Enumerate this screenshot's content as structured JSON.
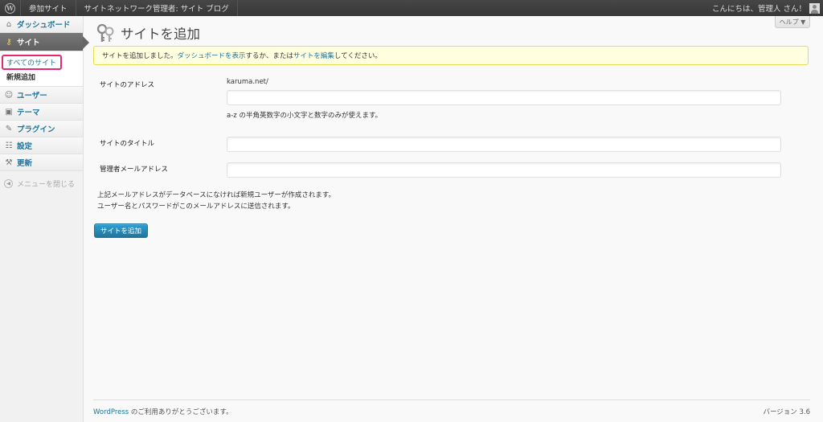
{
  "adminbar": {
    "wp_logo": "W",
    "item1": "参加サイト",
    "item2": "サイトネットワーク管理者: サイト ブログ",
    "greeting": "こんにちは、管理人 さん！"
  },
  "sidebar": {
    "dashboard": "ダッシュボード",
    "sites": "サイト",
    "sub_all_sites": "すべてのサイト",
    "sub_add_new": "新規追加",
    "users": "ユーザー",
    "themes": "テーマ",
    "plugins": "プラグイン",
    "settings": "設定",
    "updates": "更新",
    "collapse": "メニューを閉じる"
  },
  "help_tab": "ヘルプ ▼",
  "page": {
    "title": "サイトを追加",
    "notice": {
      "prefix": "サイトを追加しました。",
      "link_dashboard": "ダッシュボードを表示",
      "middle": "するか、または",
      "link_edit": "サイトを編集",
      "suffix": "してください。"
    },
    "form": {
      "address_label": "サイトのアドレス",
      "address_domain": "karuma.net/",
      "address_value": "",
      "address_hint": "a-z の半角英数字の小文字と数字のみが使えます。",
      "title_label": "サイトのタイトル",
      "title_value": "",
      "email_label": "管理者メールアドレス",
      "email_value": "",
      "note_line1": "上記メールアドレスがデータベースになければ新規ユーザーが作成されます。",
      "note_line2": "ユーザー名とパスワードがこのメールアドレスに送信されます。",
      "submit": "サイトを追加"
    }
  },
  "footer": {
    "wp_link": "WordPress",
    "thanks": " のご利用ありがとうございます。",
    "version": "バージョン 3.6"
  },
  "colors": {
    "link": "#21759b",
    "highlight": "#e8276e",
    "notice_bg": "#ffffe0",
    "notice_border": "#e6db55"
  }
}
